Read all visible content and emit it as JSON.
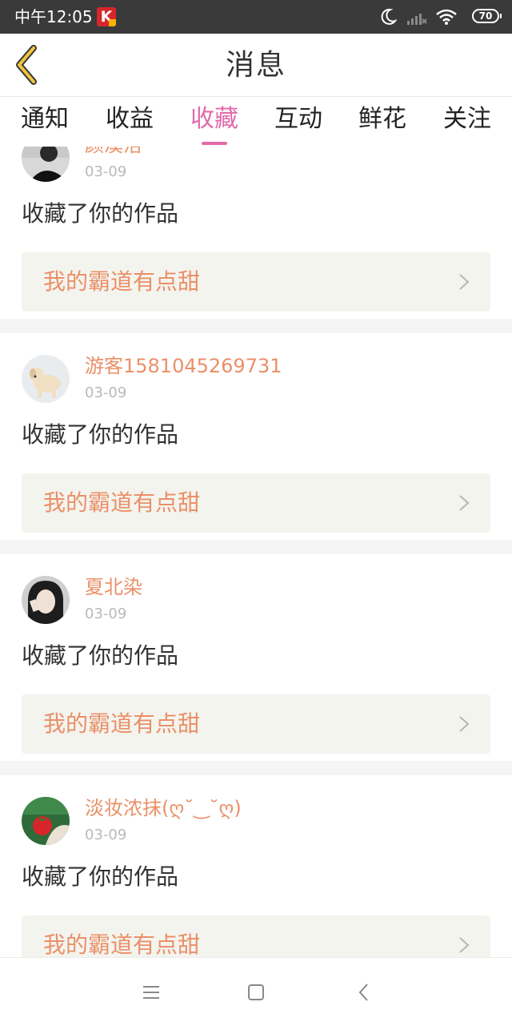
{
  "status": {
    "time": "中午12:05",
    "app_icon_letter": "K",
    "battery": "70"
  },
  "header": {
    "title": "消息",
    "back_icon": "chevron-left-icon"
  },
  "tabs": [
    {
      "label": "通知",
      "active": false
    },
    {
      "label": "收益",
      "active": false
    },
    {
      "label": "收藏",
      "active": true
    },
    {
      "label": "互动",
      "active": false
    },
    {
      "label": "鲜花",
      "active": false
    },
    {
      "label": "关注",
      "active": false
    }
  ],
  "items": [
    {
      "user": "颜溪洛",
      "date": "03-09",
      "action": "收藏了你的作品",
      "work": "我的霸道有点甜"
    },
    {
      "user": "游客1581045269731",
      "date": "03-09",
      "action": "收藏了你的作品",
      "work": "我的霸道有点甜"
    },
    {
      "user": "夏北染",
      "date": "03-09",
      "action": "收藏了你的作品",
      "work": "我的霸道有点甜"
    },
    {
      "user": "淡妆浓抹(ღ˘‿˘ღ)",
      "date": "03-09",
      "action": "收藏了你的作品",
      "work": "我的霸道有点甜"
    }
  ],
  "colors": {
    "accent": "#e26aa9",
    "name": "#ea9068",
    "status_bar": "#3a3a3a",
    "card_bg": "#f4f4ef"
  },
  "navbar": {
    "icons": [
      "menu-icon",
      "home-square-icon",
      "back-triangle-icon"
    ]
  }
}
